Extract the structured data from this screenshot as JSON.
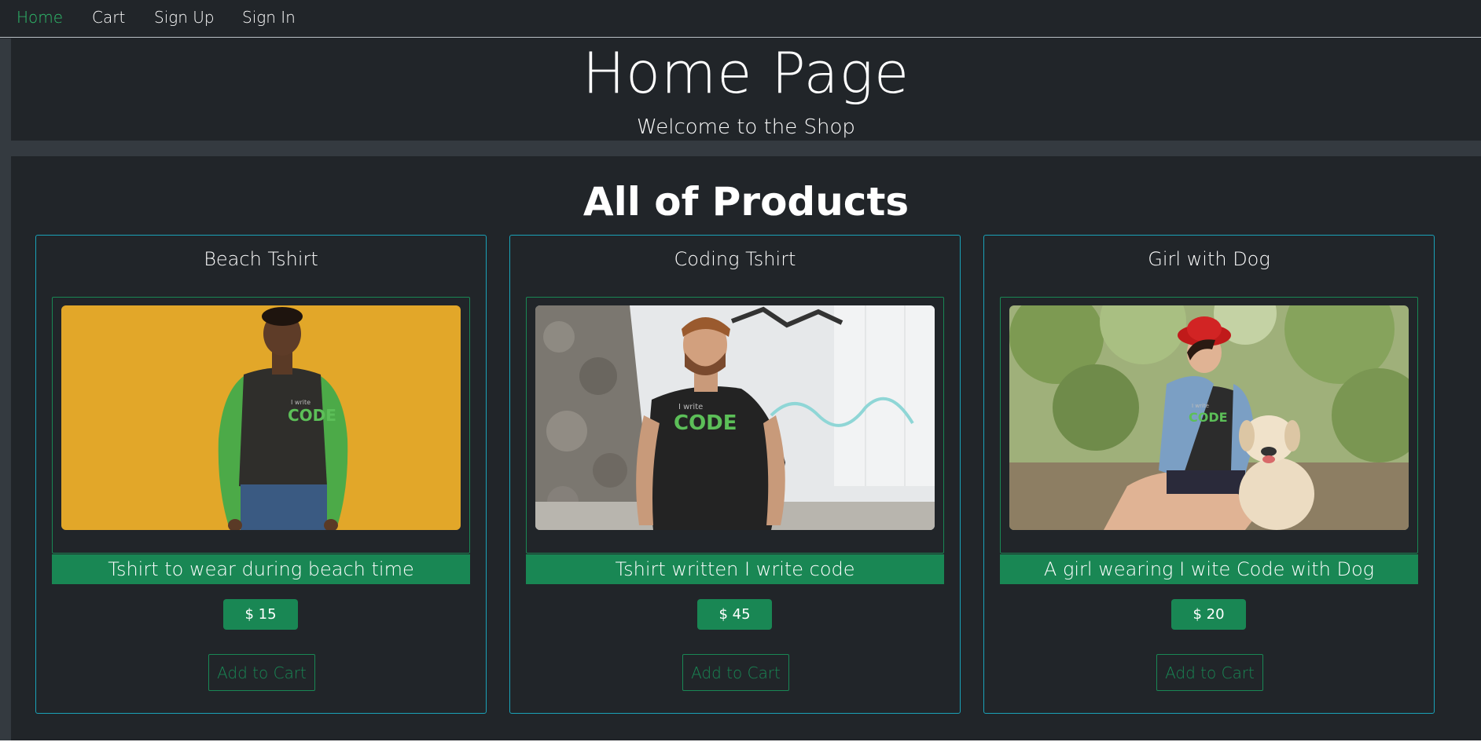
{
  "nav": {
    "items": [
      {
        "label": "Home",
        "active": true
      },
      {
        "label": "Cart",
        "active": false
      },
      {
        "label": "Sign Up",
        "active": false
      },
      {
        "label": "Sign In",
        "active": false
      }
    ]
  },
  "header": {
    "title": "Home Page",
    "subtitle": "Welcome to the Shop"
  },
  "products_section": {
    "title": "All of Products",
    "products": [
      {
        "name": "Beach Tshirt",
        "description": "Tshirt to wear during beach time",
        "price": "$ 15",
        "add_to_cart_label": "Add to Cart",
        "image_icon": "man-green-raglan-shirt-image"
      },
      {
        "name": "Coding Tshirt",
        "description": "Tshirt written I write code",
        "price": "$ 45",
        "add_to_cart_label": "Add to Cart",
        "image_icon": "man-black-tshirt-graffiti-image"
      },
      {
        "name": "Girl with Dog",
        "description": "A girl wearing I wite Code with Dog",
        "price": "$ 20",
        "add_to_cart_label": "Add to Cart",
        "image_icon": "girl-with-dog-image"
      }
    ]
  },
  "colors": {
    "background": "#212529",
    "accent_green": "#198754",
    "active_nav": "#2fbf6d",
    "card_border": "#1aa2b8"
  }
}
